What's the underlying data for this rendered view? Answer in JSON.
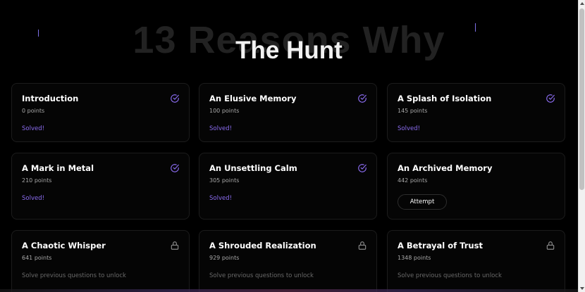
{
  "header": {
    "background_text": "13 Reasons Why",
    "title": "The Hunt"
  },
  "cards": [
    {
      "title": "Introduction",
      "points": "0 points",
      "state": "solved",
      "status": "Solved!",
      "icon": "check-circle-icon"
    },
    {
      "title": "An Elusive Memory",
      "points": "100 points",
      "state": "solved",
      "status": "Solved!",
      "icon": "check-circle-icon"
    },
    {
      "title": "A Splash of Isolation",
      "points": "145 points",
      "state": "solved",
      "status": "Solved!",
      "icon": "check-circle-icon"
    },
    {
      "title": "A Mark in Metal",
      "points": "210 points",
      "state": "solved",
      "status": "Solved!",
      "icon": "check-circle-icon"
    },
    {
      "title": "An Unsettling Calm",
      "points": "305 points",
      "state": "solved",
      "status": "Solved!",
      "icon": "check-circle-icon"
    },
    {
      "title": "An Archived Memory",
      "points": "442 points",
      "state": "open",
      "button": "Attempt"
    },
    {
      "title": "A Chaotic Whisper",
      "points": "641 points",
      "state": "locked",
      "status": "Solve previous questions to unlock",
      "icon": "lock-icon"
    },
    {
      "title": "A Shrouded Realization",
      "points": "929 points",
      "state": "locked",
      "status": "Solve previous questions to unlock",
      "icon": "lock-icon"
    },
    {
      "title": "A Betrayal of Trust",
      "points": "1348 points",
      "state": "locked",
      "status": "Solve previous questions to unlock",
      "icon": "lock-icon"
    }
  ],
  "colors": {
    "background": "#000000",
    "accent": "#8b6cf0",
    "card_border": "#1c1c1c",
    "locked_text": "#6a6a6a"
  }
}
